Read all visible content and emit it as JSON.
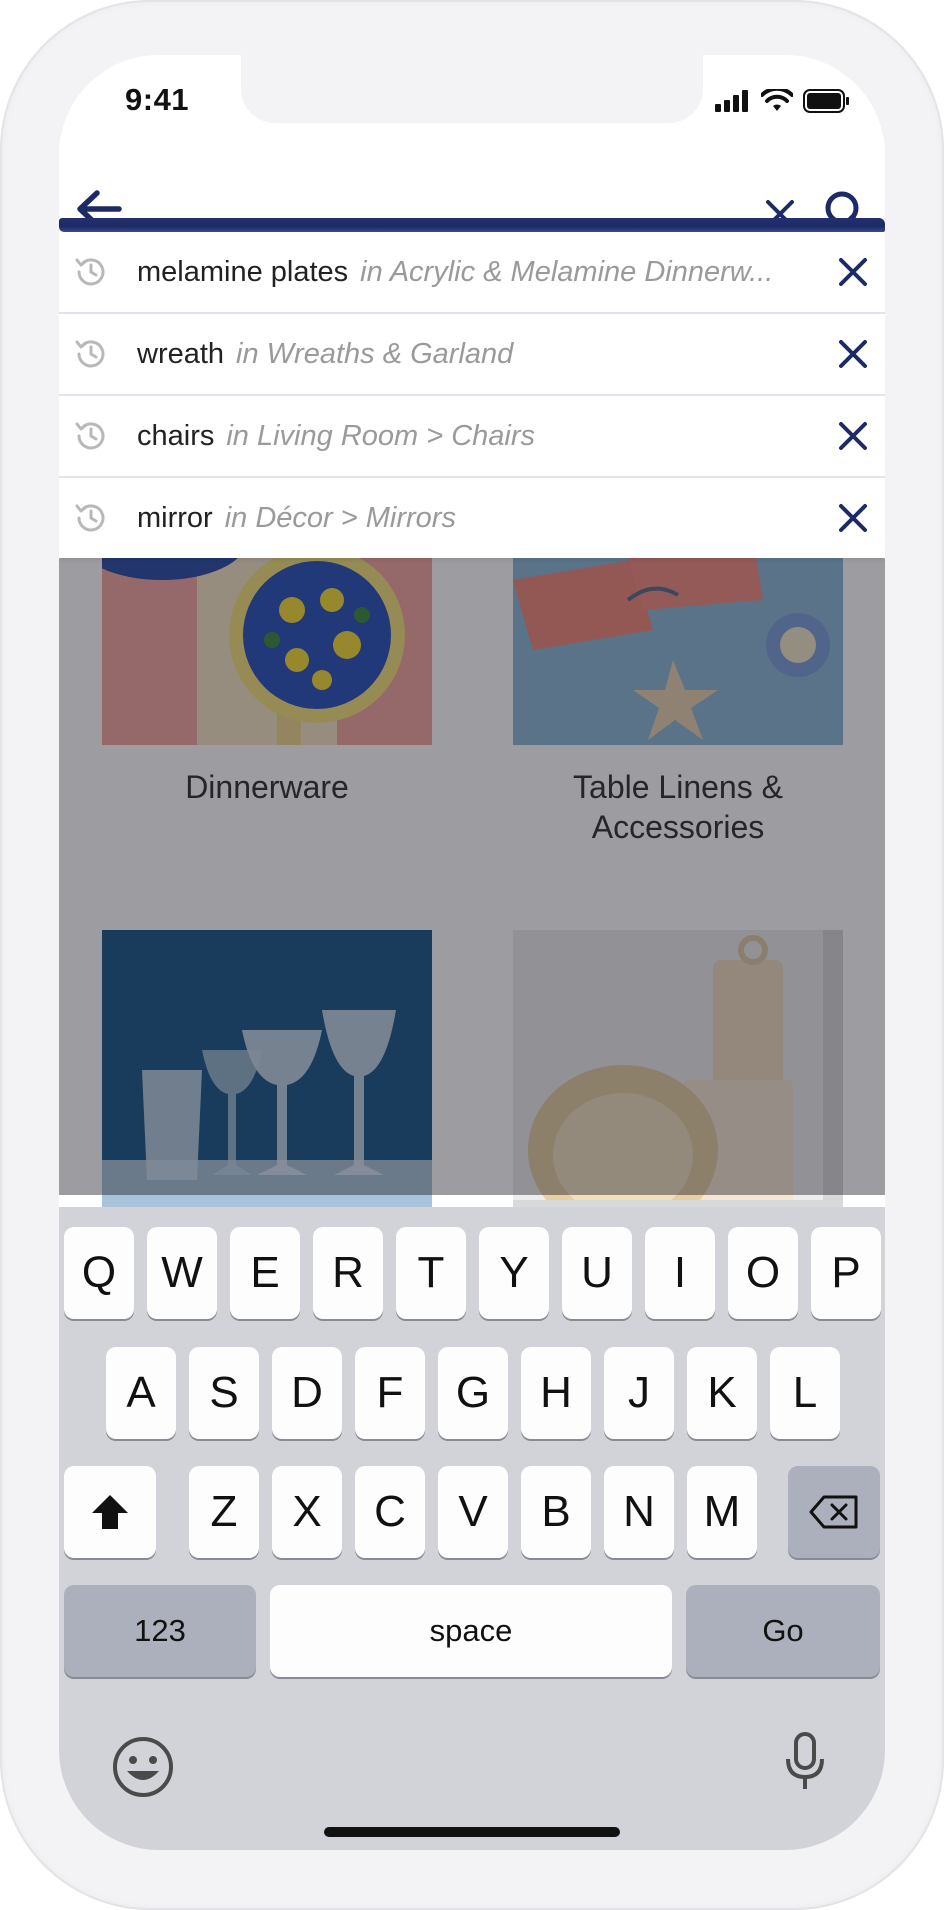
{
  "status_bar": {
    "time": "9:41"
  },
  "search": {
    "placeholder": "",
    "value": ""
  },
  "suggestions": [
    {
      "term": "melamine plates",
      "category": "in Acrylic & Melamine Dinnerw..."
    },
    {
      "term": "wreath",
      "category": "in Wreaths & Garland"
    },
    {
      "term": "chairs",
      "category": "in Living Room > Chairs"
    },
    {
      "term": "mirror",
      "category": "in Décor > Mirrors"
    }
  ],
  "categories": [
    {
      "label": "Dinnerware"
    },
    {
      "label": "Table Linens & Accessories"
    }
  ],
  "keyboard": {
    "row1": [
      "Q",
      "W",
      "E",
      "R",
      "T",
      "Y",
      "U",
      "I",
      "O",
      "P"
    ],
    "row2": [
      "A",
      "S",
      "D",
      "F",
      "G",
      "H",
      "J",
      "K",
      "L"
    ],
    "row3": [
      "Z",
      "X",
      "C",
      "V",
      "B",
      "N",
      "M"
    ],
    "numbers": "123",
    "space": "space",
    "go": "Go"
  },
  "colors": {
    "brand_navy": "#1c2a66",
    "keyboard_bg": "#d1d3d9"
  }
}
